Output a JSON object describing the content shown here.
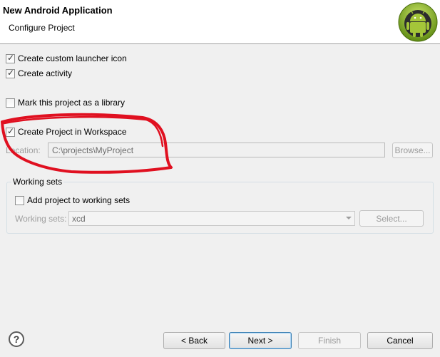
{
  "header": {
    "title": "New Android Application",
    "subtitle": "Configure Project"
  },
  "options": {
    "custom_launcher_icon": {
      "label": "Create custom launcher icon",
      "checked": true
    },
    "create_activity": {
      "label": "Create activity",
      "checked": true
    },
    "library": {
      "label": "Mark this project as a library",
      "checked": false
    },
    "workspace": {
      "label": "Create Project in Workspace",
      "checked": true
    }
  },
  "location": {
    "label": "Location:",
    "value": "C:\\projects\\MyProject",
    "browse_label": "Browse..."
  },
  "working_sets": {
    "group_title": "Working sets",
    "add_label": "Add project to working sets",
    "add_checked": false,
    "sets_label": "Working sets:",
    "sets_value": "xcd",
    "select_label": "Select..."
  },
  "footer": {
    "help_glyph": "?",
    "back_label": "< Back",
    "next_label": "Next >",
    "finish_label": "Finish",
    "cancel_label": "Cancel"
  },
  "colors": {
    "annotation": "#e01020",
    "android_green": "#97c024"
  },
  "icons": {
    "logo": "android-robot-icon",
    "help": "help-icon"
  }
}
